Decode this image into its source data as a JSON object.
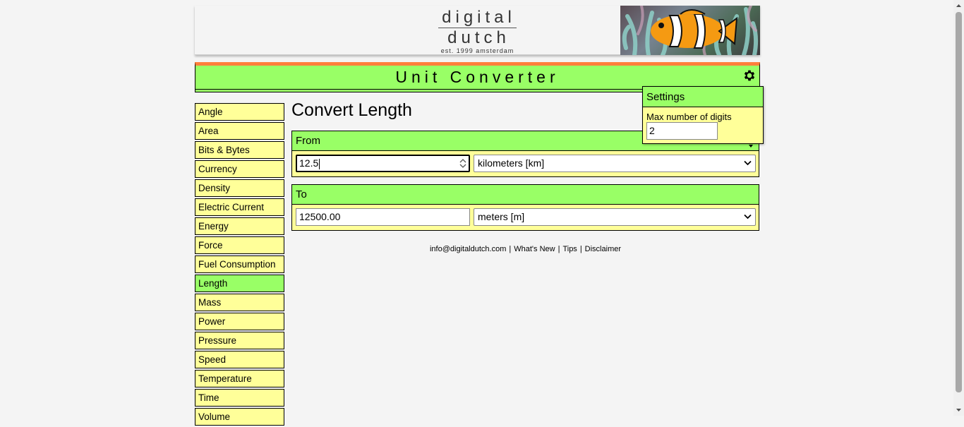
{
  "header": {
    "logo_line1": "digital",
    "logo_line2": "dutch",
    "logo_tagline": "est. 1999 amsterdam",
    "banner_image": "clownfish-anemone-photo"
  },
  "app": {
    "title": "Unit Converter",
    "settings_icon": "gear-icon"
  },
  "sidebar": {
    "items": [
      {
        "label": "Angle"
      },
      {
        "label": "Area"
      },
      {
        "label": "Bits & Bytes"
      },
      {
        "label": "Currency"
      },
      {
        "label": "Density"
      },
      {
        "label": "Electric Current"
      },
      {
        "label": "Energy"
      },
      {
        "label": "Force"
      },
      {
        "label": "Fuel Consumption"
      },
      {
        "label": "Length",
        "active": true
      },
      {
        "label": "Mass"
      },
      {
        "label": "Power"
      },
      {
        "label": "Pressure"
      },
      {
        "label": "Speed"
      },
      {
        "label": "Temperature"
      },
      {
        "label": "Time"
      },
      {
        "label": "Volume"
      }
    ]
  },
  "main": {
    "heading": "Convert Length",
    "from": {
      "label": "From",
      "value": "12.5",
      "unit": "kilometers [km]"
    },
    "to": {
      "label": "To",
      "value": "12500.00",
      "unit": "meters [m]"
    }
  },
  "footer": {
    "email": "info@digitaldutch.com",
    "whats_new": "What's New",
    "tips": "Tips",
    "disclaimer": "Disclaimer",
    "separator": "|"
  },
  "settings": {
    "title": "Settings",
    "max_digits_label": "Max number of digits",
    "max_digits_value": "2"
  },
  "colors": {
    "accent_green": "#99ff66",
    "panel_yellow": "#ffff99",
    "orange_stripe": "#ff7f3b",
    "background": "#f4f4f4"
  }
}
